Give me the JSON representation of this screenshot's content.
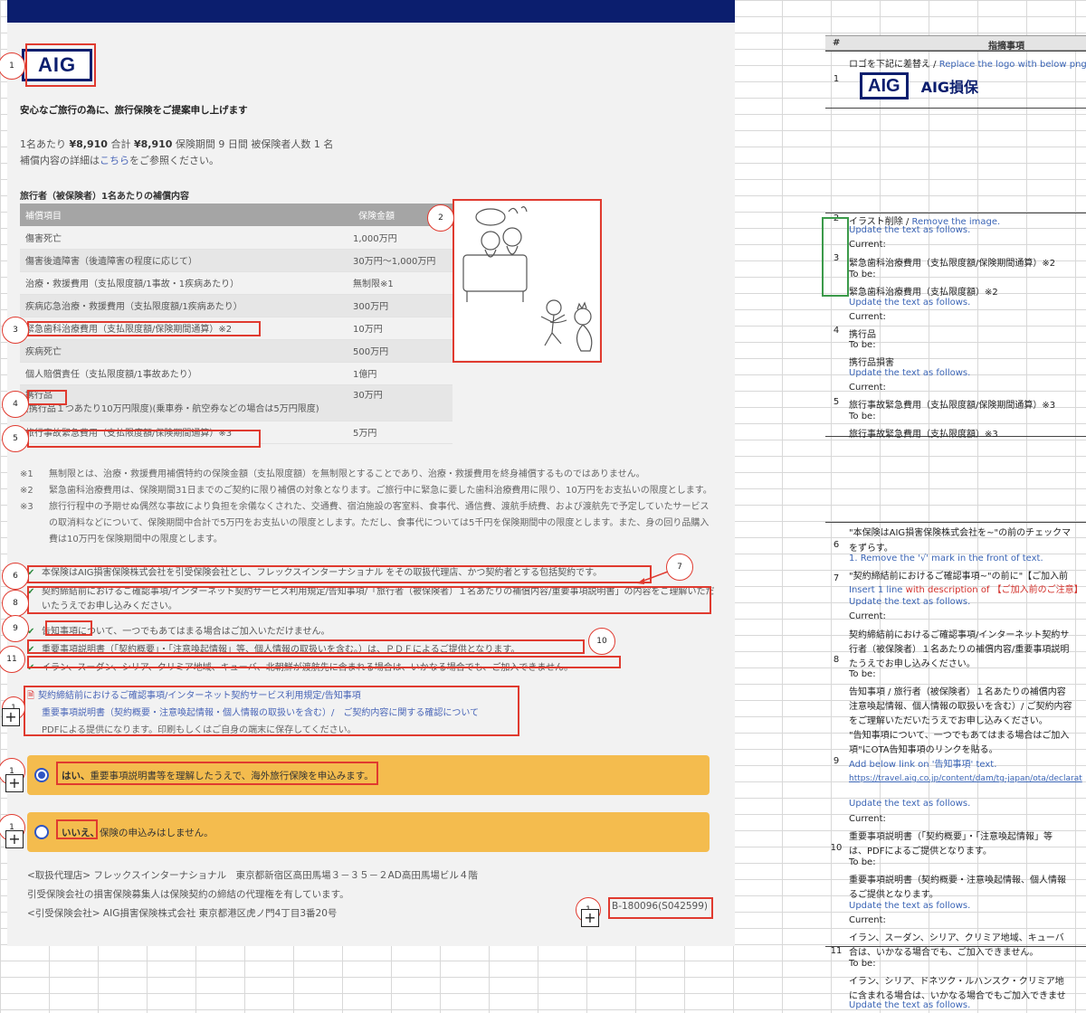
{
  "left": {
    "logo": "AIG",
    "headline": "安心なご旅行の為に、旅行保険をご提案申し上げます",
    "summary_line1": {
      "pre": "1名あたり ",
      "price1": "¥8,910",
      "mid": " 合計 ",
      "price2": "¥8,910",
      "post": " 保険期間 9 日間 被保険者人数 1 名"
    },
    "summary_line2_pre": "補償内容の詳細は",
    "summary_link": "こちら",
    "summary_line2_post": "をご参照ください。",
    "section_title": "旅行者（被保険者）1名あたりの補償内容",
    "table_headers": [
      "補償項目",
      "保険金額"
    ],
    "table_rows": [
      {
        "item": "傷害死亡",
        "amount": "1,000万円"
      },
      {
        "item": "傷害後遺障害（後遺障害の程度に応じて）",
        "amount": "30万円〜1,000万円"
      },
      {
        "item": "治療・救援費用（支払限度額/1事故・1疾病あたり）",
        "amount": "無制限※1"
      },
      {
        "item": "疾病応急治療・救援費用（支払限度額/1疾病あたり）",
        "amount": "300万円"
      },
      {
        "item": "緊急歯科治療費用（支払限度額/保険期間通算）※2",
        "amount": "10万円"
      },
      {
        "item": "疾病死亡",
        "amount": "500万円"
      },
      {
        "item": "個人賠償責任（支払限度額/1事故あたり）",
        "amount": "1億円"
      },
      {
        "item": "携行品",
        "item2": "(携行品１つあたり10万円限度)(乗車券・航空券などの場合は5万円限度)",
        "amount": "30万円"
      },
      {
        "item": "旅行事故緊急費用（支払限度額/保険期間通算）※3",
        "amount": "5万円"
      }
    ],
    "notes": [
      {
        "k": "※1",
        "t": "無制限とは、治療・救援費用補償特約の保険金額（支払限度額）を無制限とすることであり、治療・救援費用を終身補償するものではありません。"
      },
      {
        "k": "※2",
        "t": "緊急歯科治療費用は、保険期間31日までのご契約に限り補償の対象となります。ご旅行中に緊急に要した歯科治療費用に限り、10万円をお支払いの限度とします。"
      },
      {
        "k": "※3",
        "t": "旅行行程中の予期せぬ偶然な事故により負担を余儀なくされた、交通費、宿泊施設の客室料、食事代、通信費、渡航手続費、および渡航先で予定していたサービスの取消料などについて、保険期間中合計で5万円をお支払いの限度とします。ただし、食事代については5千円を保険期間中の限度とします。また、身の回り品購入費は10万円を保険期間中の限度とします。"
      }
    ],
    "checks": [
      "本保険はAIG損害保険株式会社を引受保険会社とし、フレックスインターナショナル をその取扱代理店、かつ契約者とする包括契約です。",
      "契約締結前におけるご確認事項/インターネット契約サービス利用規定/告知事項/「旅行者（被保険者）１名あたりの補償内容/重要事項説明書」の内容をご理解いただいたうえでお申し込みください。",
      "告知事項について、一つでもあてはまる場合はご加入いただけません。",
      "重要事項説明書（「契約概要」・「注意喚起情報」等、個人情報の取扱いを含む。）は、ＰＤＦによるご提供となります。",
      "イラン、スーダン、シリア、クリミア地域、キューバ、北朝鮮が渡航先に含まれる場合は、いかなる場合でも、ご加入できません。"
    ],
    "doc_line1": "契約締結前におけるご確認事項/インターネット契約サービス利用規定/告知事項",
    "doc_line2": "重要事項説明書（契約概要・注意喚起情報・個人情報の取扱いを含む）/　ご契約内容に関する確認について",
    "doc_line3": "PDFによる提供になります。印刷もしくはご自身の端末に保存してください。",
    "option_yes_bold": "はい、",
    "option_yes_rest": "重要事項説明書等を理解したうえで、海外旅行保険を申込みます。",
    "option_no_bold": "いいえ、",
    "option_no_rest": "保険の申込みはしません。",
    "footer1": "<取扱代理店> フレックスインターナショナル　東京都新宿区高田馬場３－３５－２AD高田馬場ビル４階",
    "footer2": "引受保険会社の損害保険募集人は保険契約の締結の代理権を有しています。",
    "footer3": "<引受保険会社> AIG損害保険株式会社 東京都港区虎ノ門4丁目3番20号",
    "code": "B-180096(S042599)"
  },
  "markers": [
    "1",
    "2",
    "3",
    "4",
    "5",
    "6",
    "7",
    "8",
    "9",
    "10",
    "11"
  ],
  "plus_small": "1",
  "right": {
    "header_num": "#",
    "header_title": "指摘事項",
    "r1_num": "1",
    "r1_text": "ロゴを下記に差替え / ",
    "r1_text_blue": "Replace the logo with below png",
    "r1_logo": "AIG",
    "r1_logo_text": "AIG損保",
    "r2_num": "2",
    "r2_text": "イラスト削除 / ",
    "r2_text_blue": "Remove the image.",
    "r3_num": "3",
    "update": "Update the text as follows.",
    "current": "Current:",
    "tobe": "To be:",
    "r3_cur": "緊急歯科治療費用（支払限度額/保険期間通算）※2",
    "r3_new": "緊急歯科治療費用（支払限度額）※2",
    "r4_num": "4",
    "r4_cur": "携行品",
    "r4_new": "携行品損害",
    "r5_num": "5",
    "r5_cur": "旅行事故緊急費用（支払限度額/保険期間通算）※3",
    "r5_new": "旅行事故緊急費用（支払限度額）※3",
    "r6_num": "6",
    "r6_a": "\"本保険はAIG損害保険株式会社を~\"の前のチェックマ",
    "r6_b": "をずらす。",
    "r6_c": "1. Remove the '√' mark in the front of text.",
    "r7_num": "7",
    "r7_a": "\"契約締結前におけるご確認事項~\"の前に\"【ご加入前",
    "r7_b_blue": "Insert 1 line ",
    "r7_b_red": "with description of 【ご加入前のご注意】",
    "r8_num": "8",
    "r8_cur1": "契約締結前におけるご確認事項/インターネット契約サ",
    "r8_cur2": "行者（被保険者）１名あたりの補償内容/重要事項説明",
    "r8_cur3": "たうえでお申し込みください。",
    "r8_new1": "告知事項 / 旅行者（被保険者）１名あたりの補償内容",
    "r8_new2": "注意喚起情報、個人情報の取扱いを含む）/ ご契約内容",
    "r8_new3": "をご理解いただいたうえでお申し込みください。",
    "r9_num": "9",
    "r9_a": "\"告知事項について、一つでもあてはまる場合はご加入",
    "r9_b": "項\"にOTA告知事項のリンクを貼る。",
    "r9_c": "Add below link on '告知事項' text.",
    "r9_link": "https://travel.aig.co.jp/content/dam/tg-japan/ota/declarat",
    "r10_num": "10",
    "r10_cur1": "重要事項説明書（「契約概要」・「注意喚起情報」等",
    "r10_cur2": "は、PDFによるご提供となります。",
    "r10_new1": "重要事項説明書（契約概要・注意喚起情報、個人情報",
    "r10_new2": "るご提供となります。",
    "r11_num": "11",
    "r11_cur1": "イラン、スーダン、シリア、クリミア地域、キューバ",
    "r11_cur2": "合は、いかなる場合でも、ご加入できません。",
    "r11_new1": "イラン、シリア、ドネツク・ルハンスク・クリミア地",
    "r11_new2": "に含まれる場合は、いかなる場合でもご加入できませ"
  }
}
